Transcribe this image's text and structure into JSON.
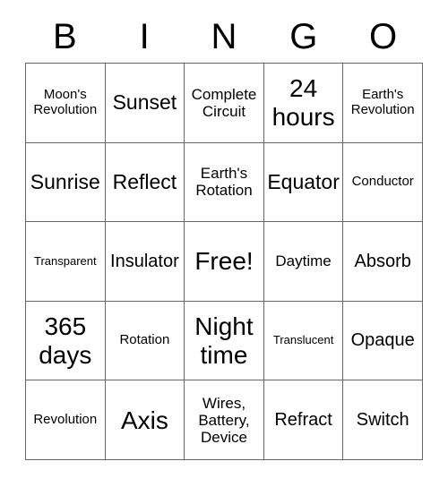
{
  "card": {
    "header_letters": [
      "B",
      "I",
      "N",
      "G",
      "O"
    ],
    "colors": {
      "text": "#000000",
      "grid_line": "#666666",
      "background": "#ffffff"
    },
    "rows": [
      [
        {
          "text": "Moon's Revolution",
          "size": "sm"
        },
        {
          "text": "Sunset",
          "size": "xl"
        },
        {
          "text": "Complete Circuit",
          "size": "md"
        },
        {
          "text": "24 hours",
          "size": "xxl"
        },
        {
          "text": "Earth's Revolution",
          "size": "sm"
        }
      ],
      [
        {
          "text": "Sunrise",
          "size": "xl"
        },
        {
          "text": "Reflect",
          "size": "xl"
        },
        {
          "text": "Earth's Rotation",
          "size": "md"
        },
        {
          "text": "Equator",
          "size": "xl"
        },
        {
          "text": "Conductor",
          "size": "sm"
        }
      ],
      [
        {
          "text": "Transparent",
          "size": "xs"
        },
        {
          "text": "Insulator",
          "size": "lg"
        },
        {
          "text": "Free!",
          "size": "xxl"
        },
        {
          "text": "Daytime",
          "size": "md"
        },
        {
          "text": "Absorb",
          "size": "lg"
        }
      ],
      [
        {
          "text": "365 days",
          "size": "xxl"
        },
        {
          "text": "Rotation",
          "size": "sm"
        },
        {
          "text": "Night time",
          "size": "xxl"
        },
        {
          "text": "Translucent",
          "size": "xs"
        },
        {
          "text": "Opaque",
          "size": "lg"
        }
      ],
      [
        {
          "text": "Revolution",
          "size": "sm"
        },
        {
          "text": "Axis",
          "size": "xxl"
        },
        {
          "text": "Wires, Battery, Device",
          "size": "md"
        },
        {
          "text": "Refract",
          "size": "lg"
        },
        {
          "text": "Switch",
          "size": "lg"
        }
      ]
    ]
  }
}
